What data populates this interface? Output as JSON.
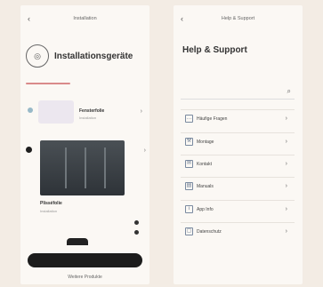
{
  "left": {
    "topbar_title": "Installation",
    "back_icon": "chevron-left-icon",
    "header_title": "Installationsgeräte",
    "header_desc": "",
    "product": {
      "name": "Fensterfolie",
      "sub": "Installation"
    },
    "feature": {
      "title": "Plisséfolie",
      "sub": "Installation"
    },
    "bottom_label": "",
    "primary_button": "",
    "secondary_link": "Weitere Produkte"
  },
  "right": {
    "topbar_title": "Help & Support",
    "back_icon": "chevron-left-icon",
    "title": "Help & Support",
    "desc": "",
    "search_placeholder": "",
    "menu": [
      {
        "label": "Häufige Fragen",
        "icon": "chat-icon"
      },
      {
        "label": "Montage",
        "icon": "wrench-icon"
      },
      {
        "label": "Kontakt",
        "icon": "envelope-icon"
      },
      {
        "label": "Manuals",
        "icon": "book-icon"
      },
      {
        "label": "App Info",
        "icon": "info-icon"
      },
      {
        "label": "Datenschutz",
        "icon": "lock-icon"
      }
    ]
  },
  "colors": {
    "accent": "#d98a8a",
    "button": "#1c1c1c",
    "background": "#f3ece4"
  }
}
